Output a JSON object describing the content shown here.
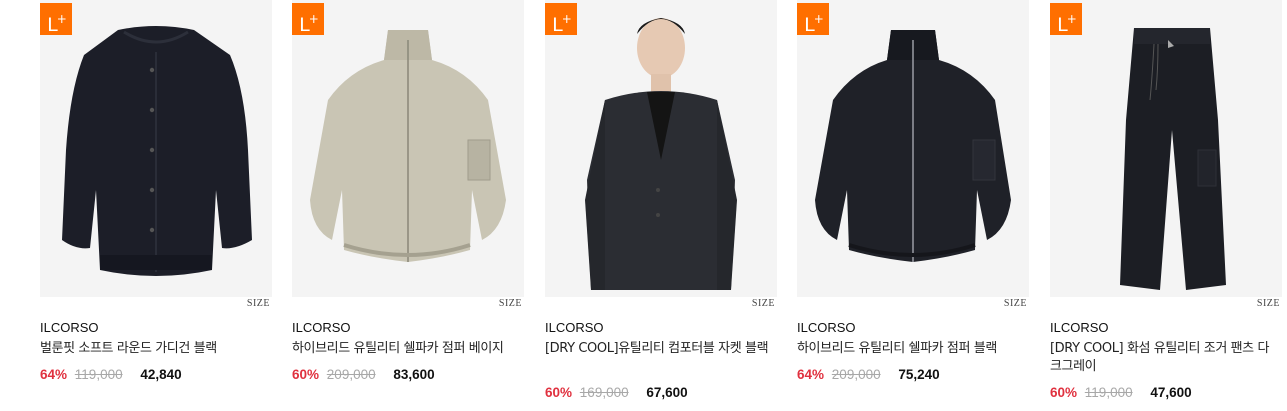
{
  "badge_label": "L",
  "badge_plus": "+",
  "badge_color": "#ff6f00",
  "discount_color": "#e0313f",
  "products": [
    {
      "image": "black-knit-cardigan",
      "size_tag": "SIZE",
      "brand": "ILCORSO",
      "name": "벌룬핏 소프트 라운드 가디건 블랙",
      "discount": "64%",
      "original_price": "119,000",
      "sale_price": "42,840"
    },
    {
      "image": "beige-zip-jumper",
      "size_tag": "SIZE",
      "brand": "ILCORSO",
      "name": "하이브리드 유틸리티 쉘파카 점퍼 베이지",
      "discount": "60%",
      "original_price": "209,000",
      "sale_price": "83,600"
    },
    {
      "image": "model-black-blazer",
      "size_tag": "SIZE",
      "brand": "ILCORSO",
      "name": "[DRY COOL]유틸리티 컴포터블 자켓 블랙",
      "discount": "60%",
      "original_price": "169,000",
      "sale_price": "67,600"
    },
    {
      "image": "black-zip-jumper",
      "size_tag": "SIZE",
      "brand": "ILCORSO",
      "name": "하이브리드 유틸리티 쉘파카 점퍼 블랙",
      "discount": "64%",
      "original_price": "209,000",
      "sale_price": "75,240"
    },
    {
      "image": "charcoal-jogger-pants",
      "size_tag": "SIZE",
      "brand": "ILCORSO",
      "name": "[DRY COOL] 화섬 유틸리티 조거 팬츠 다크그레이",
      "discount": "60%",
      "original_price": "119,000",
      "sale_price": "47,600"
    }
  ]
}
